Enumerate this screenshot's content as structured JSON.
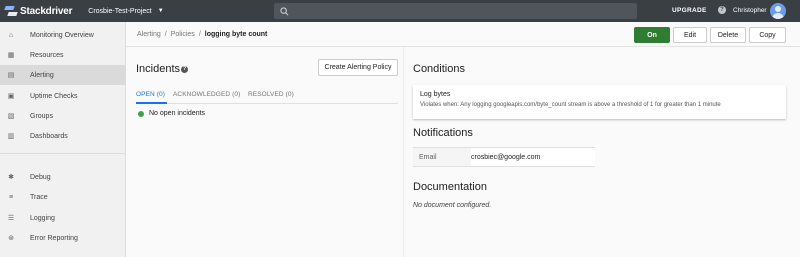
{
  "topbar": {
    "brand": "Stackdriver",
    "project": "Crosbie-Test-Project",
    "search_placeholder": "",
    "upgrade": "UPGRADE",
    "help": "?",
    "user": "Christopher"
  },
  "sidebar": {
    "items": [
      {
        "label": "Monitoring Overview",
        "icon": "home-icon"
      },
      {
        "label": "Resources",
        "icon": "resources-icon"
      },
      {
        "label": "Alerting",
        "icon": "alerting-icon"
      },
      {
        "label": "Uptime Checks",
        "icon": "uptime-icon"
      },
      {
        "label": "Groups",
        "icon": "groups-icon"
      },
      {
        "label": "Dashboards",
        "icon": "dashboards-icon"
      },
      {
        "label": "Debug",
        "icon": "debug-icon"
      },
      {
        "label": "Trace",
        "icon": "trace-icon"
      },
      {
        "label": "Logging",
        "icon": "logging-icon"
      },
      {
        "label": "Error Reporting",
        "icon": "error-reporting-icon"
      }
    ]
  },
  "breadcrumb": {
    "alerting": "Alerting",
    "sep": "/",
    "policies": "Policies",
    "current": "logging byte count"
  },
  "toolbar": {
    "on": "On",
    "edit": "Edit",
    "delete": "Delete",
    "copy": "Copy"
  },
  "incidents": {
    "title": "Incidents",
    "help": "?",
    "create_button": "Create Alerting Policy",
    "tabs": [
      "OPEN (0)",
      "ACKNOWLEDGED (0)",
      "RESOLVED (0)"
    ],
    "empty": "No open incidents"
  },
  "conditions": {
    "title": "Conditions",
    "name": "Log bytes",
    "description": "Violates when: Any logging googleapis.com/byte_count stream is above a threshold of 1 for greater than 1 minute"
  },
  "notifications": {
    "title": "Notifications",
    "label": "Email",
    "value": "crosbiec@google.com"
  },
  "documentation": {
    "title": "Documentation",
    "text": "No document configured."
  },
  "colors": {
    "topbar": "#3a3f44",
    "on_button": "#2e7d32",
    "tab_active": "#1a73e8",
    "status_ok": "#43a047"
  }
}
